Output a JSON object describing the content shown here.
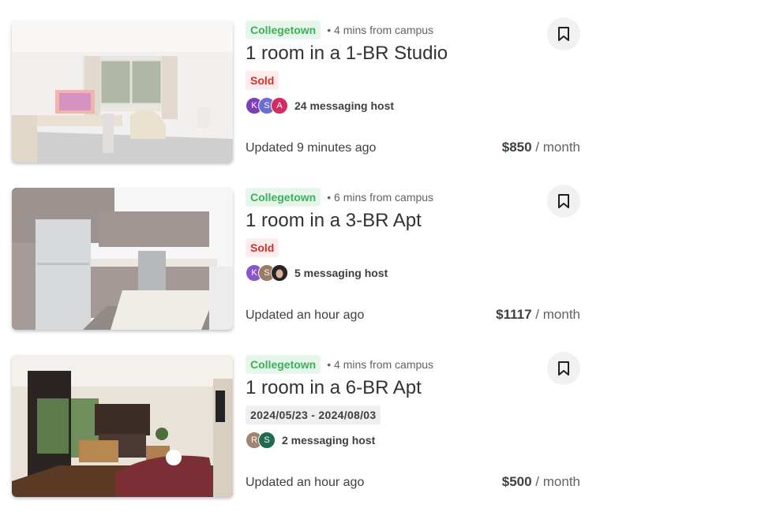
{
  "listings": [
    {
      "area": "Collegetown",
      "distance": "• 4 mins from campus",
      "title": "1 room in a 1-BR Studio",
      "status": "Sold",
      "avatars": [
        {
          "initial": "K",
          "color": "#7b3fb8"
        },
        {
          "initial": "S",
          "color": "#6a6fd1"
        },
        {
          "initial": "A",
          "color": "#d22d63"
        }
      ],
      "messaging": "24 messaging host",
      "updated": "Updated 9 minutes ago",
      "price": "$850",
      "per": " / month",
      "photo_icon": "studio-room-photo"
    },
    {
      "area": "Collegetown",
      "distance": "• 6 mins from campus",
      "title": "1 room in a 3-BR Apt",
      "status": "Sold",
      "avatars": [
        {
          "initial": "K",
          "color": "#8a55c9"
        },
        {
          "initial": "S",
          "color": "#9a7b63"
        },
        {
          "initial": "",
          "color": "#3a3030"
        }
      ],
      "messaging": "5 messaging host",
      "updated": "Updated an hour ago",
      "price": "$1117",
      "per": " / month",
      "photo_icon": "kitchen-photo"
    },
    {
      "area": "Collegetown",
      "distance": "• 4 mins from campus",
      "title": "1 room in a 6-BR Apt",
      "dates": "2024/05/23 - 2024/08/03",
      "avatars": [
        {
          "initial": "R",
          "color": "#a08473"
        },
        {
          "initial": "S",
          "color": "#1e6b4e"
        }
      ],
      "messaging": "2 messaging host",
      "updated": "Updated an hour ago",
      "price": "$500",
      "per": " / month",
      "photo_icon": "living-room-photo"
    }
  ]
}
